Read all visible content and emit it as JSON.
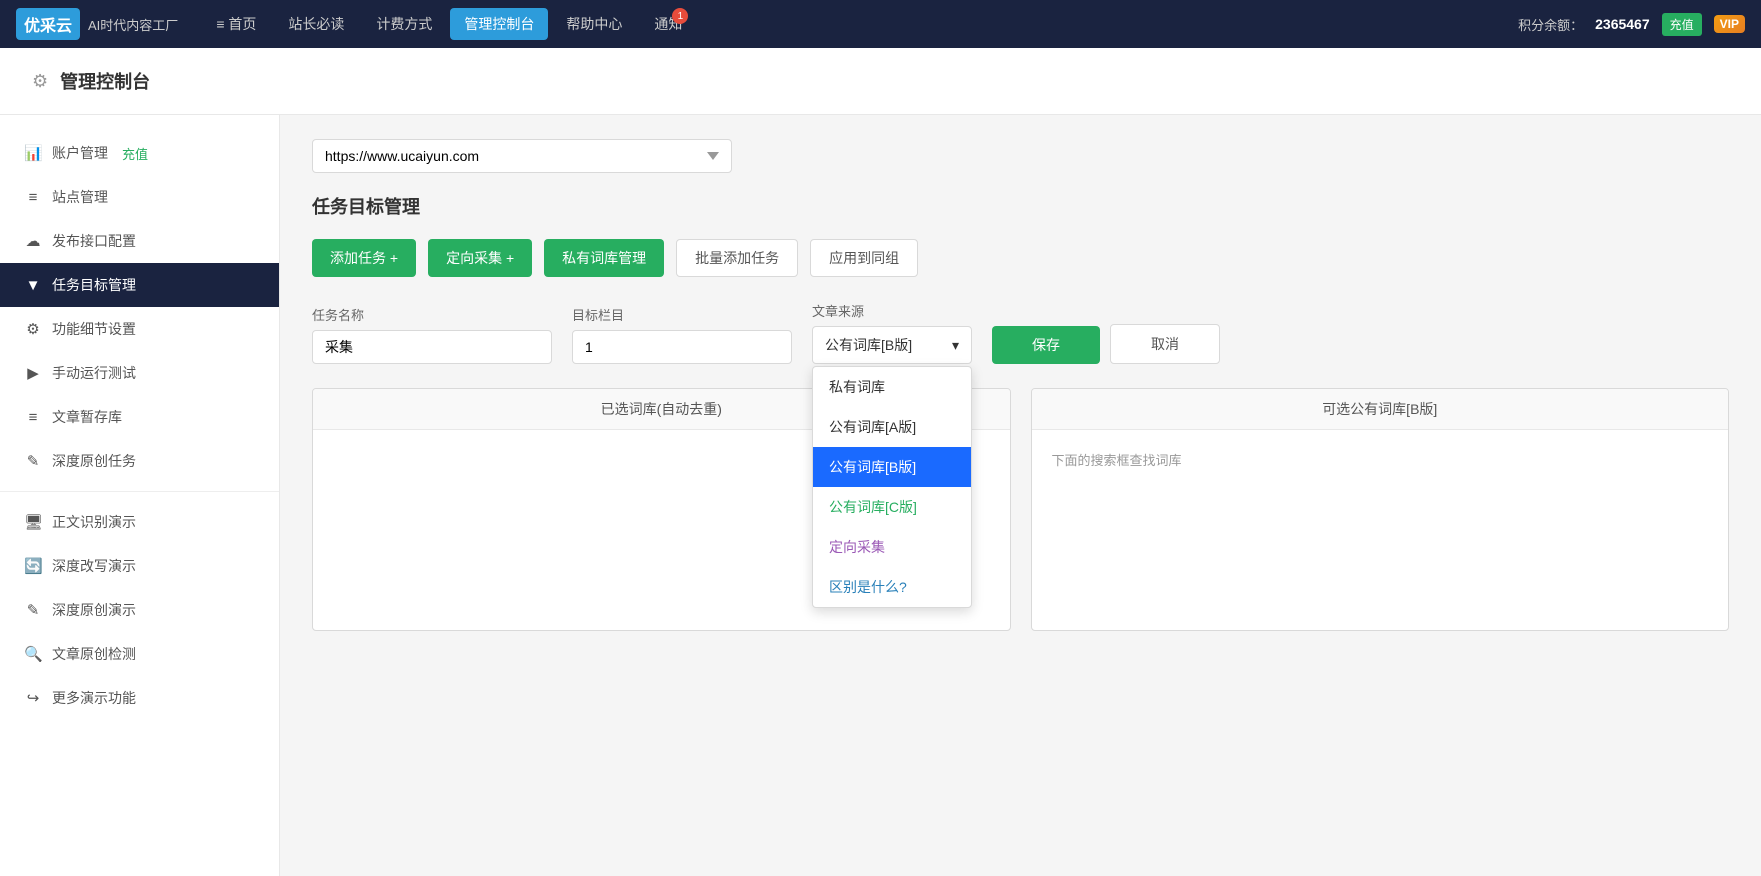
{
  "topNav": {
    "logoBox": "优采云",
    "logoTagline": "AI时代内容工厂",
    "navItems": [
      {
        "id": "home",
        "label": "首页",
        "icon": "≡",
        "active": false
      },
      {
        "id": "webmaster",
        "label": "站长必读",
        "active": false
      },
      {
        "id": "pricing",
        "label": "计费方式",
        "active": false
      },
      {
        "id": "dashboard",
        "label": "管理控制台",
        "active": true
      },
      {
        "id": "help",
        "label": "帮助中心",
        "active": false
      },
      {
        "id": "notification",
        "label": "通知",
        "active": false,
        "badge": "1"
      }
    ],
    "pointsLabel": "积分余额：",
    "pointsValue": "2365467",
    "rechargeLabel": "充值",
    "vipLabel": "VIP"
  },
  "pageHeader": {
    "icon": "⚙",
    "title": "管理控制台"
  },
  "sidebar": {
    "items": [
      {
        "id": "account",
        "icon": "📊",
        "label": "账户管理",
        "recharge": "充值",
        "active": false
      },
      {
        "id": "site",
        "icon": "≡",
        "label": "站点管理",
        "active": false
      },
      {
        "id": "publish",
        "icon": "☁",
        "label": "发布接口配置",
        "active": false
      },
      {
        "id": "task",
        "icon": "▼",
        "label": "任务目标管理",
        "active": true
      },
      {
        "id": "settings",
        "icon": "⚙",
        "label": "功能细节设置",
        "active": false
      },
      {
        "id": "manual",
        "icon": "▶",
        "label": "手动运行测试",
        "active": false
      },
      {
        "id": "draft",
        "icon": "≡",
        "label": "文章暂存库",
        "active": false
      },
      {
        "id": "original",
        "icon": "✎",
        "label": "深度原创任务",
        "active": false
      },
      {
        "id": "recognition",
        "icon": "🖥",
        "label": "正文识别演示",
        "active": false
      },
      {
        "id": "rewrite",
        "icon": "🔄",
        "label": "深度改写演示",
        "active": false
      },
      {
        "id": "original-demo",
        "icon": "✎",
        "label": "深度原创演示",
        "active": false
      },
      {
        "id": "check",
        "icon": "🔍",
        "label": "文章原创检测",
        "active": false
      },
      {
        "id": "more",
        "icon": "↪",
        "label": "更多演示功能",
        "active": false
      }
    ]
  },
  "content": {
    "siteSelectValue": "https://www.ucaiyun.com",
    "siteOptions": [
      "https://www.ucaiyun.com"
    ],
    "sectionTitle": "任务目标管理",
    "buttons": {
      "addTask": "添加任务 +",
      "directedCollect": "定向采集 +",
      "privateLibrary": "私有词库管理",
      "batchAdd": "批量添加任务",
      "applyToGroup": "应用到同组"
    },
    "form": {
      "taskNameLabel": "任务名称",
      "taskNameValue": "采集",
      "targetColumnLabel": "目标栏目",
      "targetColumnValue": "1",
      "sourceLabel": "文章来源",
      "sourceSelected": "公有词库[B版]",
      "sourceOptions": [
        {
          "id": "private",
          "label": "私有词库",
          "type": "normal"
        },
        {
          "id": "public-a",
          "label": "公有词库[A版]",
          "type": "normal"
        },
        {
          "id": "public-b",
          "label": "公有词库[B版]",
          "type": "selected"
        },
        {
          "id": "public-c",
          "label": "公有词库[C版]",
          "type": "green"
        },
        {
          "id": "directed",
          "label": "定向采集",
          "type": "purple"
        },
        {
          "id": "difference",
          "label": "区别是什么?",
          "type": "blue"
        }
      ],
      "saveLabel": "保存",
      "cancelLabel": "取消"
    },
    "panels": {
      "leftHeader": "已选词库(自动去重)",
      "rightHeader": "可选公有词库[B版]",
      "rightHint": "下面的搜索框查找词库"
    }
  }
}
